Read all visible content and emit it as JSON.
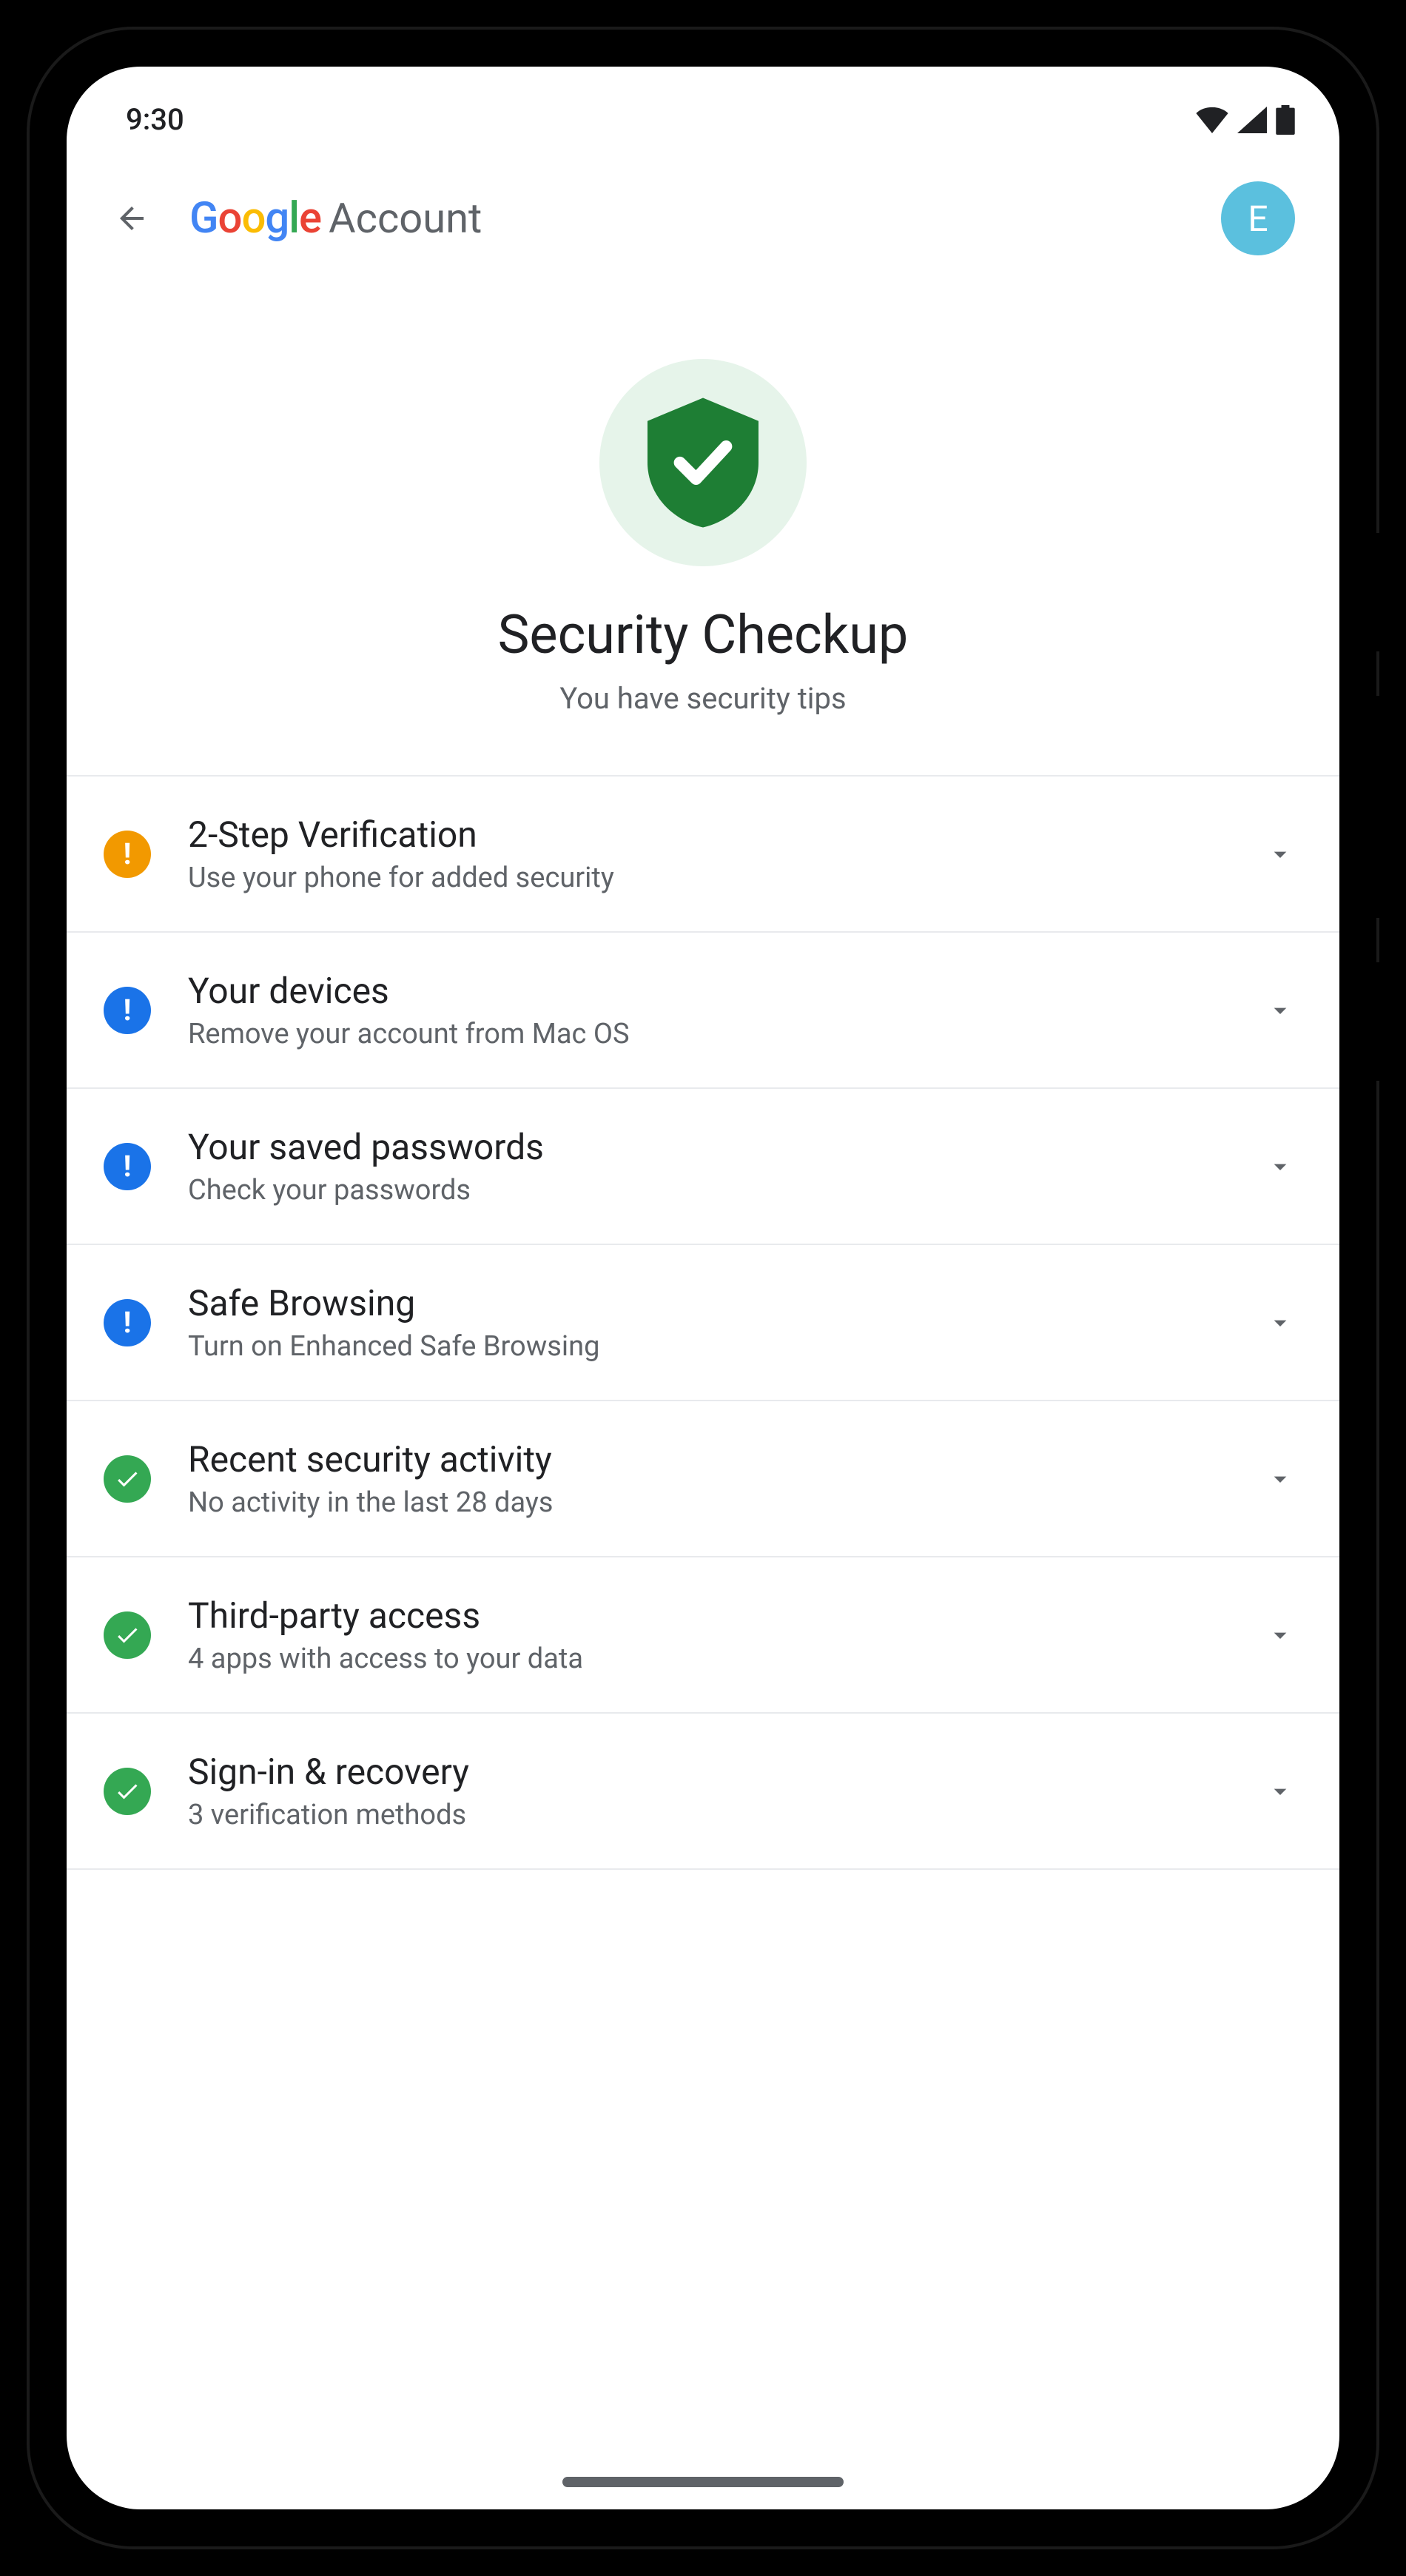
{
  "statusbar": {
    "time": "9:30"
  },
  "appbar": {
    "logo_text": "Google",
    "account_text": "Account",
    "avatar_initial": "E"
  },
  "hero": {
    "title": "Security Checkup",
    "subtitle": "You have security tips"
  },
  "items": [
    {
      "status": "warn",
      "title": "2-Step Verification",
      "subtitle": "Use your phone for added security"
    },
    {
      "status": "info",
      "title": "Your devices",
      "subtitle": "Remove your account from Mac OS"
    },
    {
      "status": "info",
      "title": "Your saved passwords",
      "subtitle": "Check your passwords"
    },
    {
      "status": "info",
      "title": "Safe Browsing",
      "subtitle": "Turn on Enhanced Safe Browsing"
    },
    {
      "status": "ok",
      "title": "Recent security activity",
      "subtitle": "No activity in the last 28 days"
    },
    {
      "status": "ok",
      "title": "Third-party access",
      "subtitle": "4 apps with access to your data"
    },
    {
      "status": "ok",
      "title": "Sign-in & recovery",
      "subtitle": "3 verification methods"
    }
  ]
}
